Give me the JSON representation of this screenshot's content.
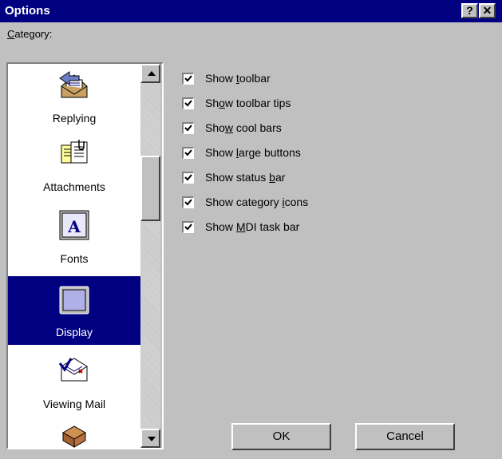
{
  "window": {
    "title": "Options",
    "help_btn": "?",
    "close_btn": "✕"
  },
  "category": {
    "label": "Category:",
    "items": [
      {
        "label": "Replying",
        "icon": "replying-icon"
      },
      {
        "label": "Attachments",
        "icon": "attachments-icon"
      },
      {
        "label": "Fonts",
        "icon": "fonts-icon"
      },
      {
        "label": "Display",
        "icon": "display-icon",
        "selected": true
      },
      {
        "label": "Viewing Mail",
        "icon": "viewing-mail-icon"
      },
      {
        "label": "",
        "icon": "tray-icon"
      }
    ]
  },
  "options": [
    {
      "pre": "Show ",
      "key": "t",
      "post": "oolbar",
      "checked": true
    },
    {
      "pre": "Sh",
      "key": "o",
      "post": "w toolbar tips",
      "checked": true
    },
    {
      "pre": "Sho",
      "key": "w",
      "post": " cool bars",
      "checked": true
    },
    {
      "pre": "Show ",
      "key": "l",
      "post": "arge buttons",
      "checked": true
    },
    {
      "pre": "Show status ",
      "key": "b",
      "post": "ar",
      "checked": true
    },
    {
      "pre": "Show category ",
      "key": "i",
      "post": "cons",
      "checked": true
    },
    {
      "pre": "Show ",
      "key": "M",
      "post": "DI task bar",
      "checked": true
    }
  ],
  "buttons": {
    "ok": "OK",
    "cancel": "Cancel"
  },
  "colors": {
    "title_bg": "#000080",
    "face": "#c0c0c0",
    "selection": "#000080"
  }
}
